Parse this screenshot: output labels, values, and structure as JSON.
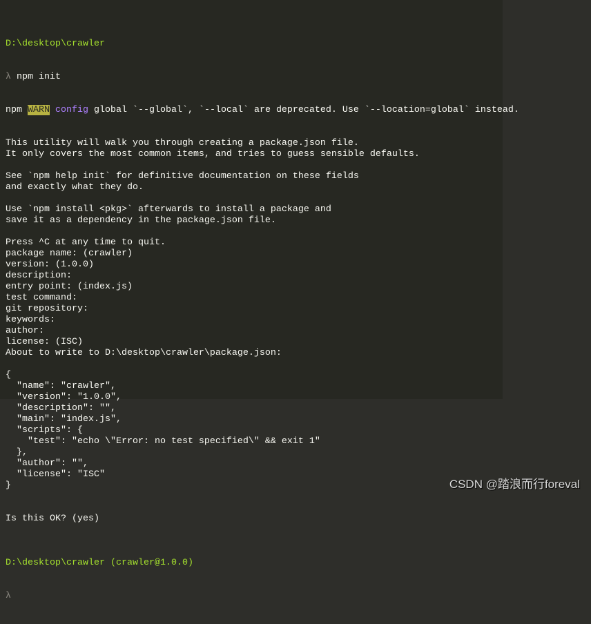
{
  "prompt1": {
    "path": "D:\\desktop\\crawler",
    "lambda": "λ",
    "command": "npm init"
  },
  "warn_line": {
    "npm": "npm ",
    "warn": "WARN",
    "config": " config",
    "rest": " global `--global`, `--local` are deprecated. Use `--location=global` instead."
  },
  "output": [
    "This utility will walk you through creating a package.json file.",
    "It only covers the most common items, and tries to guess sensible defaults.",
    "",
    "See `npm help init` for definitive documentation on these fields",
    "and exactly what they do.",
    "",
    "Use `npm install <pkg>` afterwards to install a package and",
    "save it as a dependency in the package.json file.",
    "",
    "Press ^C at any time to quit.",
    "package name: (crawler)",
    "version: (1.0.0)",
    "description:",
    "entry point: (index.js)",
    "test command:",
    "git repository:",
    "keywords:",
    "author:",
    "license: (ISC)",
    "About to write to D:\\desktop\\crawler\\package.json:",
    "",
    "{",
    "  \"name\": \"crawler\",",
    "  \"version\": \"1.0.0\",",
    "  \"description\": \"\",",
    "  \"main\": \"index.js\",",
    "  \"scripts\": {",
    "    \"test\": \"echo \\\"Error: no test specified\\\" && exit 1\"",
    "  },",
    "  \"author\": \"\",",
    "  \"license\": \"ISC\"",
    "}",
    "",
    "",
    "Is this OK? (yes)",
    ""
  ],
  "prompt2": {
    "path": "D:\\desktop\\crawler (crawler@1.0.0)",
    "lambda": "λ"
  },
  "watermark": "CSDN @踏浪而行foreval"
}
